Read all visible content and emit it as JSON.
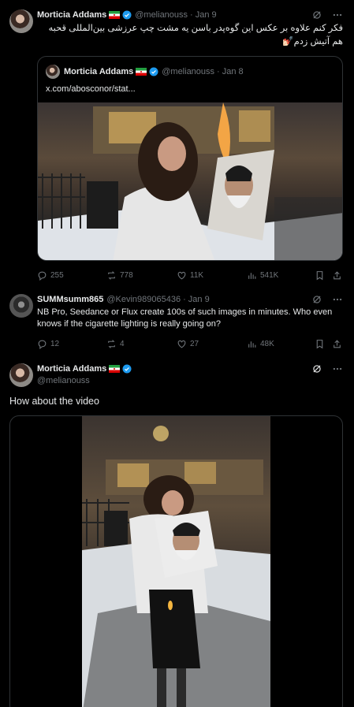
{
  "post1": {
    "name": "Morticia Addams",
    "handle": "@melianouss",
    "date": "Jan 9",
    "text": "فکر کنم علاوه بر عکس این گوه‌پدر باسن یه مشت چپ عرزشی بین‌المللی قحبه هم آتیش زدم💅🏻",
    "quote": {
      "name": "Morticia Addams",
      "handle": "@melianouss",
      "date": "Jan 8",
      "link": "x.com/abosconor/stat..."
    },
    "replies": "255",
    "reposts": "778",
    "likes": "11K",
    "views": "541K"
  },
  "post2": {
    "name": "SUMMsumm865",
    "handle": "@Kevin989065436",
    "date": "Jan 9",
    "text": "NB Pro, Seedance or Flux create 100s of such images in minutes. Who even knows if the cigarette lighting is really going on?",
    "replies": "12",
    "reposts": "4",
    "likes": "27",
    "views": "48K"
  },
  "post3": {
    "name": "Morticia Addams",
    "handle": "@melianouss",
    "text": "How about the video"
  },
  "icons": {
    "grok": "grok-icon",
    "more": "more-icon",
    "reply": "reply-icon",
    "repost": "repost-icon",
    "like": "heart-icon",
    "views": "views-icon",
    "bookmark": "bookmark-icon",
    "share": "share-icon"
  },
  "colors": {
    "verified": "#1d9bf0",
    "secondary_text": "#71767b",
    "border": "#2f3336"
  }
}
